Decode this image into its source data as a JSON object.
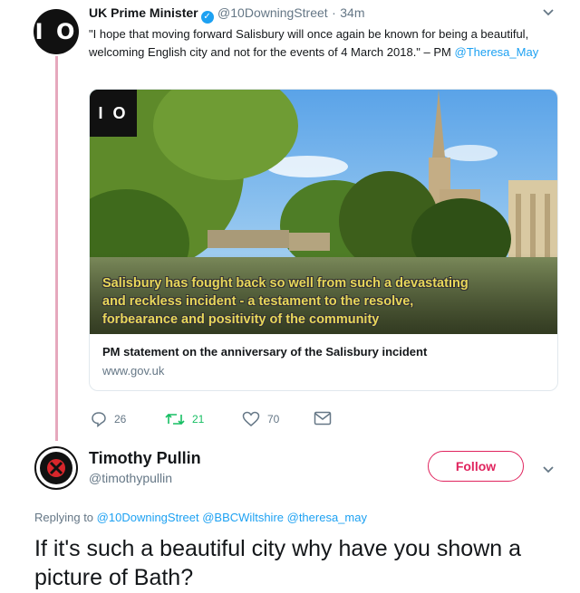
{
  "tweet": {
    "avatar_text": "I O",
    "author_name": "UK Prime Minister",
    "author_handle": "@10DowningStreet",
    "separator": "·",
    "time": "34m",
    "text": "\"I hope that moving forward Salisbury will once again be known for being a beautiful, welcoming English city and not for the events of 4 March 2018.\" – PM",
    "mention": "@Theresa_May",
    "card": {
      "logo_text": "I O",
      "overlay_line1": "Salisbury has fought back so well from such a devastating",
      "overlay_line2": "and reckless incident - a testament to the resolve,",
      "overlay_line3": "forbearance and positivity of the community",
      "title": "PM statement on the anniversary of the Salisbury incident",
      "domain": "www.gov.uk"
    },
    "actions": {
      "replies": "26",
      "retweets": "21",
      "likes": "70"
    }
  },
  "reply": {
    "author_name": "Timothy Pullin",
    "author_handle": "@timothypullin",
    "follow_label": "Follow",
    "replying_prefix": "Replying to",
    "replying_to": [
      "@10DowningStreet",
      "@BBCWiltshire",
      "@theresa_may"
    ],
    "text": "If it's such a beautiful city why have you shown a picture of Bath?"
  },
  "colors": {
    "link": "#1da1f2",
    "follow": "#e0245e",
    "retweet": "#17bf63",
    "thread_line": "#e6a8bd"
  }
}
